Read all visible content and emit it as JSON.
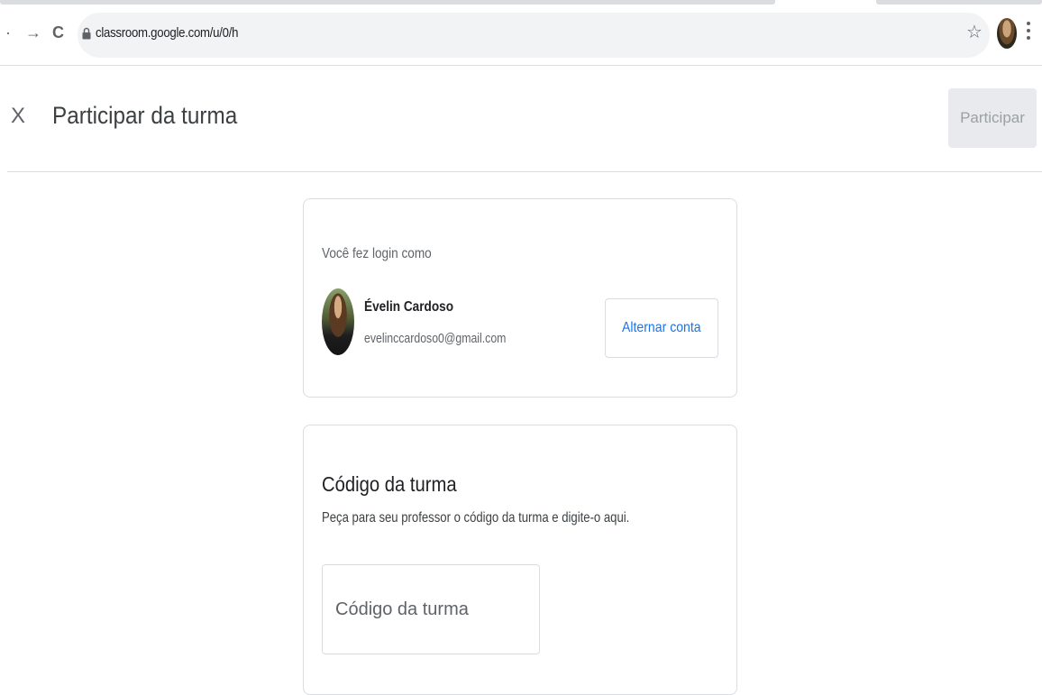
{
  "browser": {
    "url": "classroom.google.com/u/0/h",
    "back_glyph": "·",
    "forward_glyph": "→",
    "reload_glyph": "C",
    "star_glyph": "☆"
  },
  "header": {
    "close_glyph": "X",
    "title": "Participar da turma",
    "join_label": "Participar"
  },
  "account": {
    "signed_in_label": "Você fez login como",
    "name": "Évelin Cardoso",
    "email": "evelinccardoso0@gmail.com",
    "switch_label": "Alternar conta"
  },
  "class_code": {
    "title": "Código da turma",
    "hint": "Peça para seu professor o código da turma e digite-o aqui.",
    "input_placeholder": "Código da turma",
    "input_value": ""
  },
  "colors": {
    "accent": "#1a73e8",
    "disabled_bg": "#e8eaed",
    "border": "#dadce0"
  }
}
